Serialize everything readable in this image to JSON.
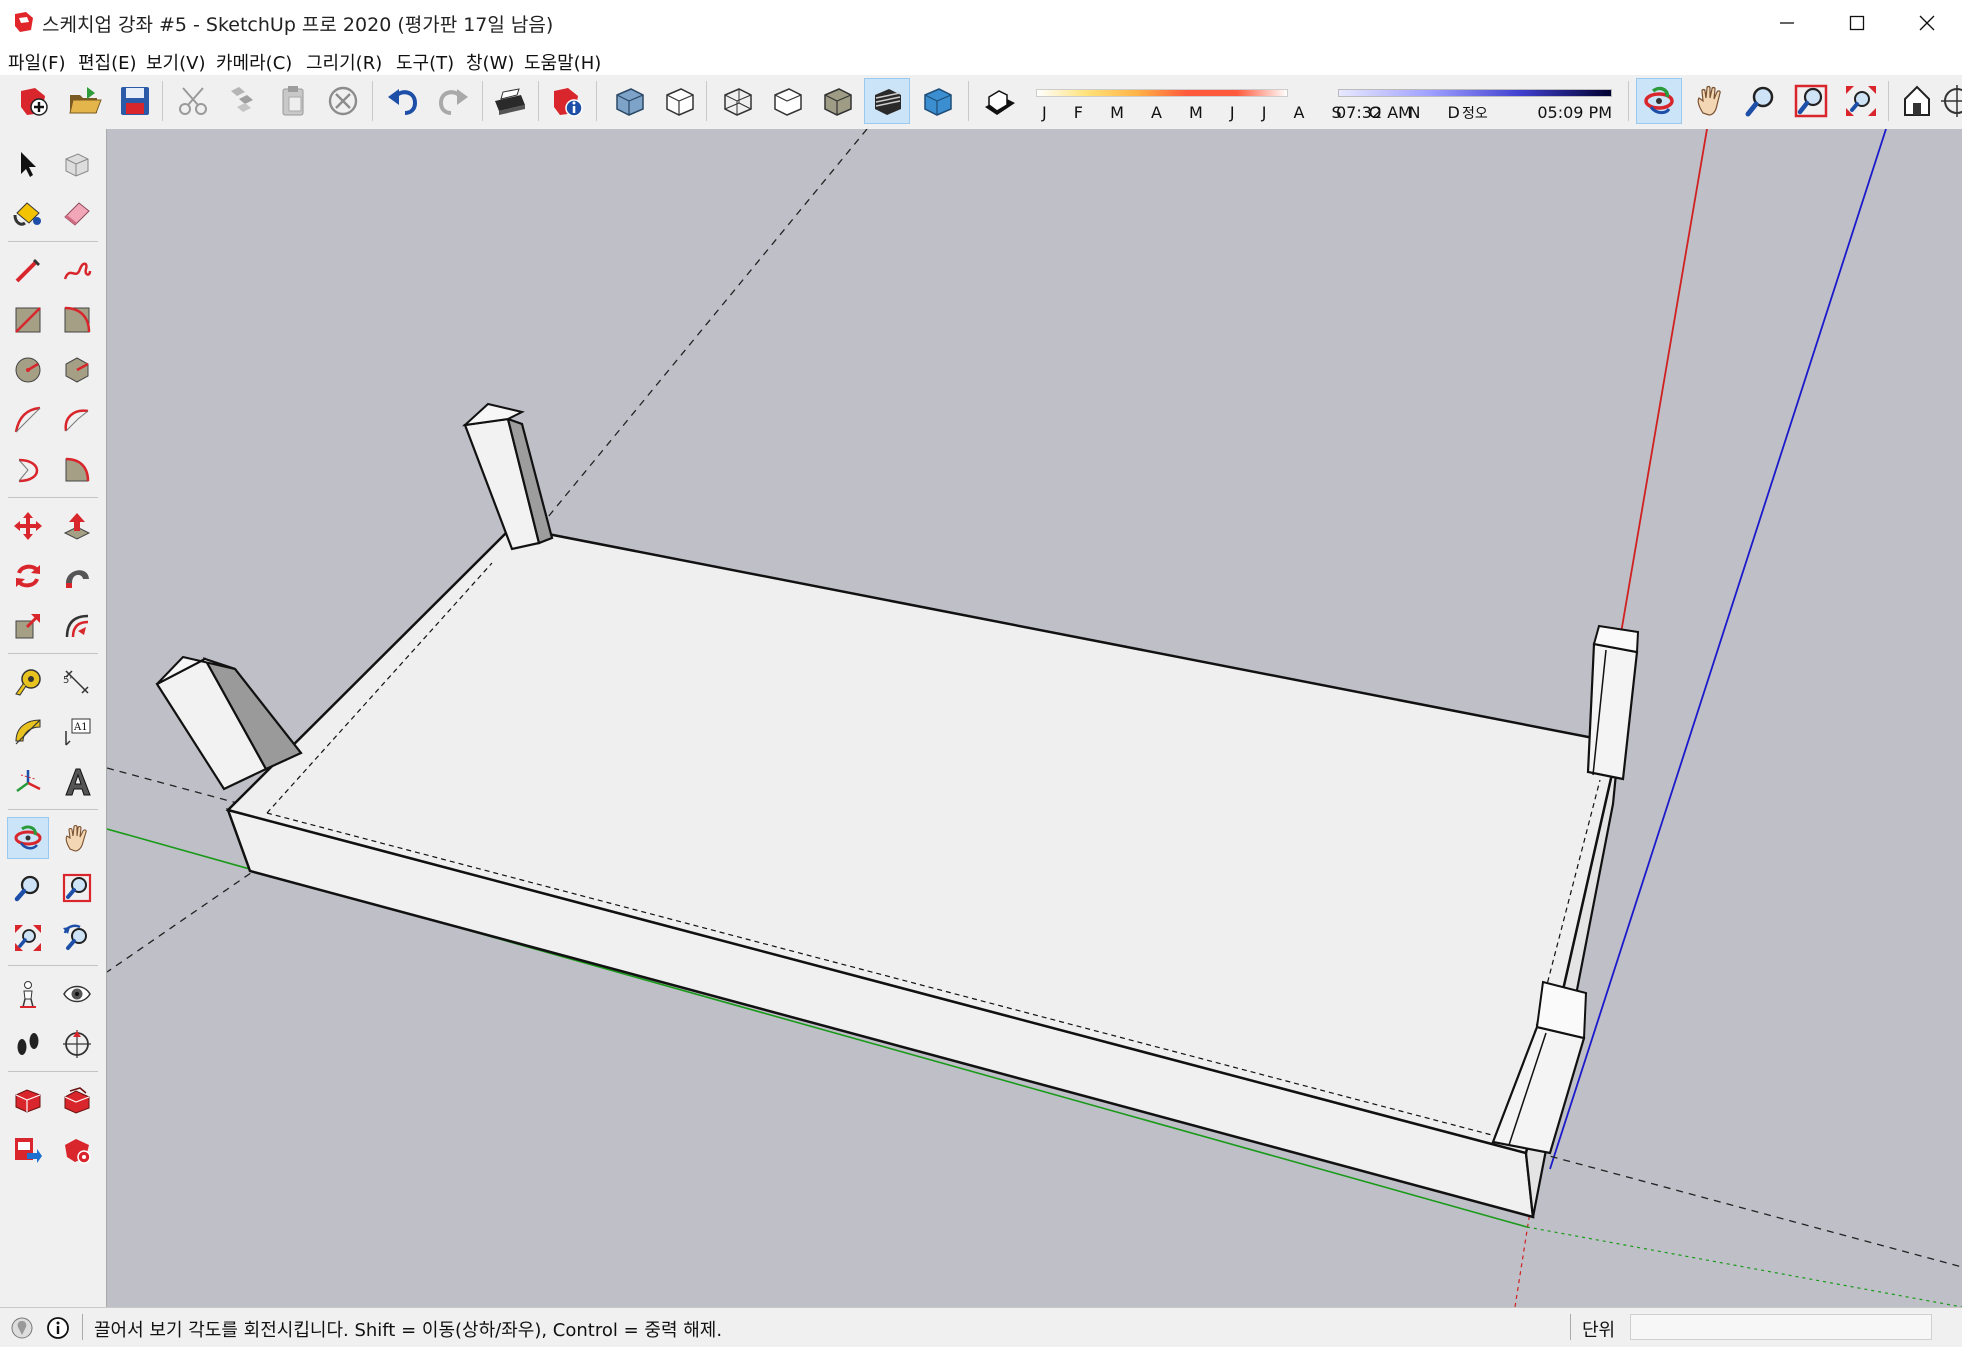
{
  "window": {
    "title": "스케치업 강좌 #5 - SketchUp 프로 2020 (평가판 17일 남음)"
  },
  "menu": [
    "파일(F)",
    "편집(E)",
    "보기(V)",
    "카메라(C)",
    "그리기(R)",
    "도구(T)",
    "창(W)",
    "도움말(H)"
  ],
  "shadow": {
    "months": "J F M A M J J A S O N D",
    "time_start": "07:32 AM",
    "time_noon": "정오",
    "time_end": "05:09 PM"
  },
  "status": {
    "hint": "끌어서 보기 각도를 회전시킵니다. Shift = 이동(상하/좌우), Control = 중력 해제.",
    "units_label": "단위",
    "units_value": ""
  },
  "colors": {
    "viewport_bg": "#bfbfc7",
    "red_axis": "#d02020",
    "green_axis": "#1a9a1a",
    "blue_axis": "#1a1acc",
    "face_light": "#efefef",
    "face_dark": "#a6a6a6",
    "active_tool": "#cce4f7"
  },
  "icons": {
    "toolbar": [
      "new-icon",
      "open-icon",
      "save-icon",
      "cut-icon",
      "copy-icon",
      "paste-icon",
      "erase-icon",
      "undo-icon",
      "redo-icon",
      "print-icon",
      "model-info-icon",
      "xray-icon",
      "back-edges-icon",
      "wireframe-icon",
      "hidden-line-icon",
      "shaded-icon",
      "shaded-textures-icon",
      "monochrome-icon",
      "shadows-icon",
      "orbit-icon",
      "pan-icon",
      "zoom-icon",
      "zoom-window-icon",
      "zoom-extents-icon",
      "warehouse-icon",
      "position-camera-icon"
    ],
    "left": [
      "select-icon",
      "component-icon",
      "paint-bucket-icon",
      "eraser-icon",
      "line-icon",
      "freehand-icon",
      "rectangle-icon",
      "rotated-rectangle-icon",
      "circle-icon",
      "polygon-icon",
      "arc-icon",
      "two-point-arc-icon",
      "three-point-arc-icon",
      "pie-icon",
      "move-icon",
      "push-pull-icon",
      "rotate-icon",
      "follow-me-icon",
      "scale-icon",
      "offset-icon",
      "tape-measure-icon",
      "dimension-icon",
      "protractor-icon",
      "text-icon",
      "axes-icon",
      "3d-text-icon",
      "orbit-icon",
      "pan-icon",
      "zoom-icon",
      "zoom-window-icon",
      "zoom-extents-icon",
      "previous-view-icon",
      "position-camera-icon",
      "look-around-icon",
      "walk-icon",
      "section-plane-icon",
      "warehouse-icon",
      "extension-warehouse-icon",
      "send-to-layout-icon",
      "extension-manager-icon"
    ]
  }
}
